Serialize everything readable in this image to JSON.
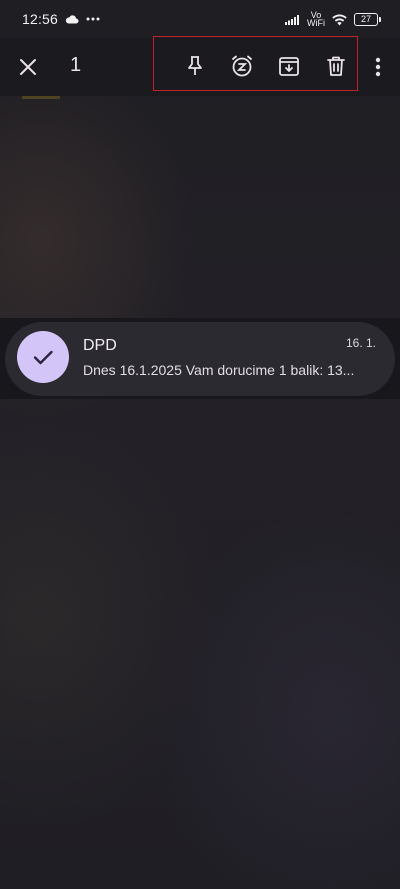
{
  "status_bar": {
    "time": "12:56",
    "volte_line1": "Vo",
    "volte_line2": "WiFi",
    "battery_level": "27"
  },
  "action_bar": {
    "selected_count": "1",
    "highlight_color": "#c0222b",
    "icons": [
      "close-icon",
      "pin-icon",
      "snooze-icon",
      "archive-icon",
      "delete-icon",
      "more-vert-icon"
    ]
  },
  "mail": {
    "sender": "DPD",
    "snippet": "Dnes 16.1.2025 Vam dorucime 1 balik: 13...",
    "date": "16. 1.",
    "selected": true,
    "avatar_color": "#d3c5f8"
  }
}
